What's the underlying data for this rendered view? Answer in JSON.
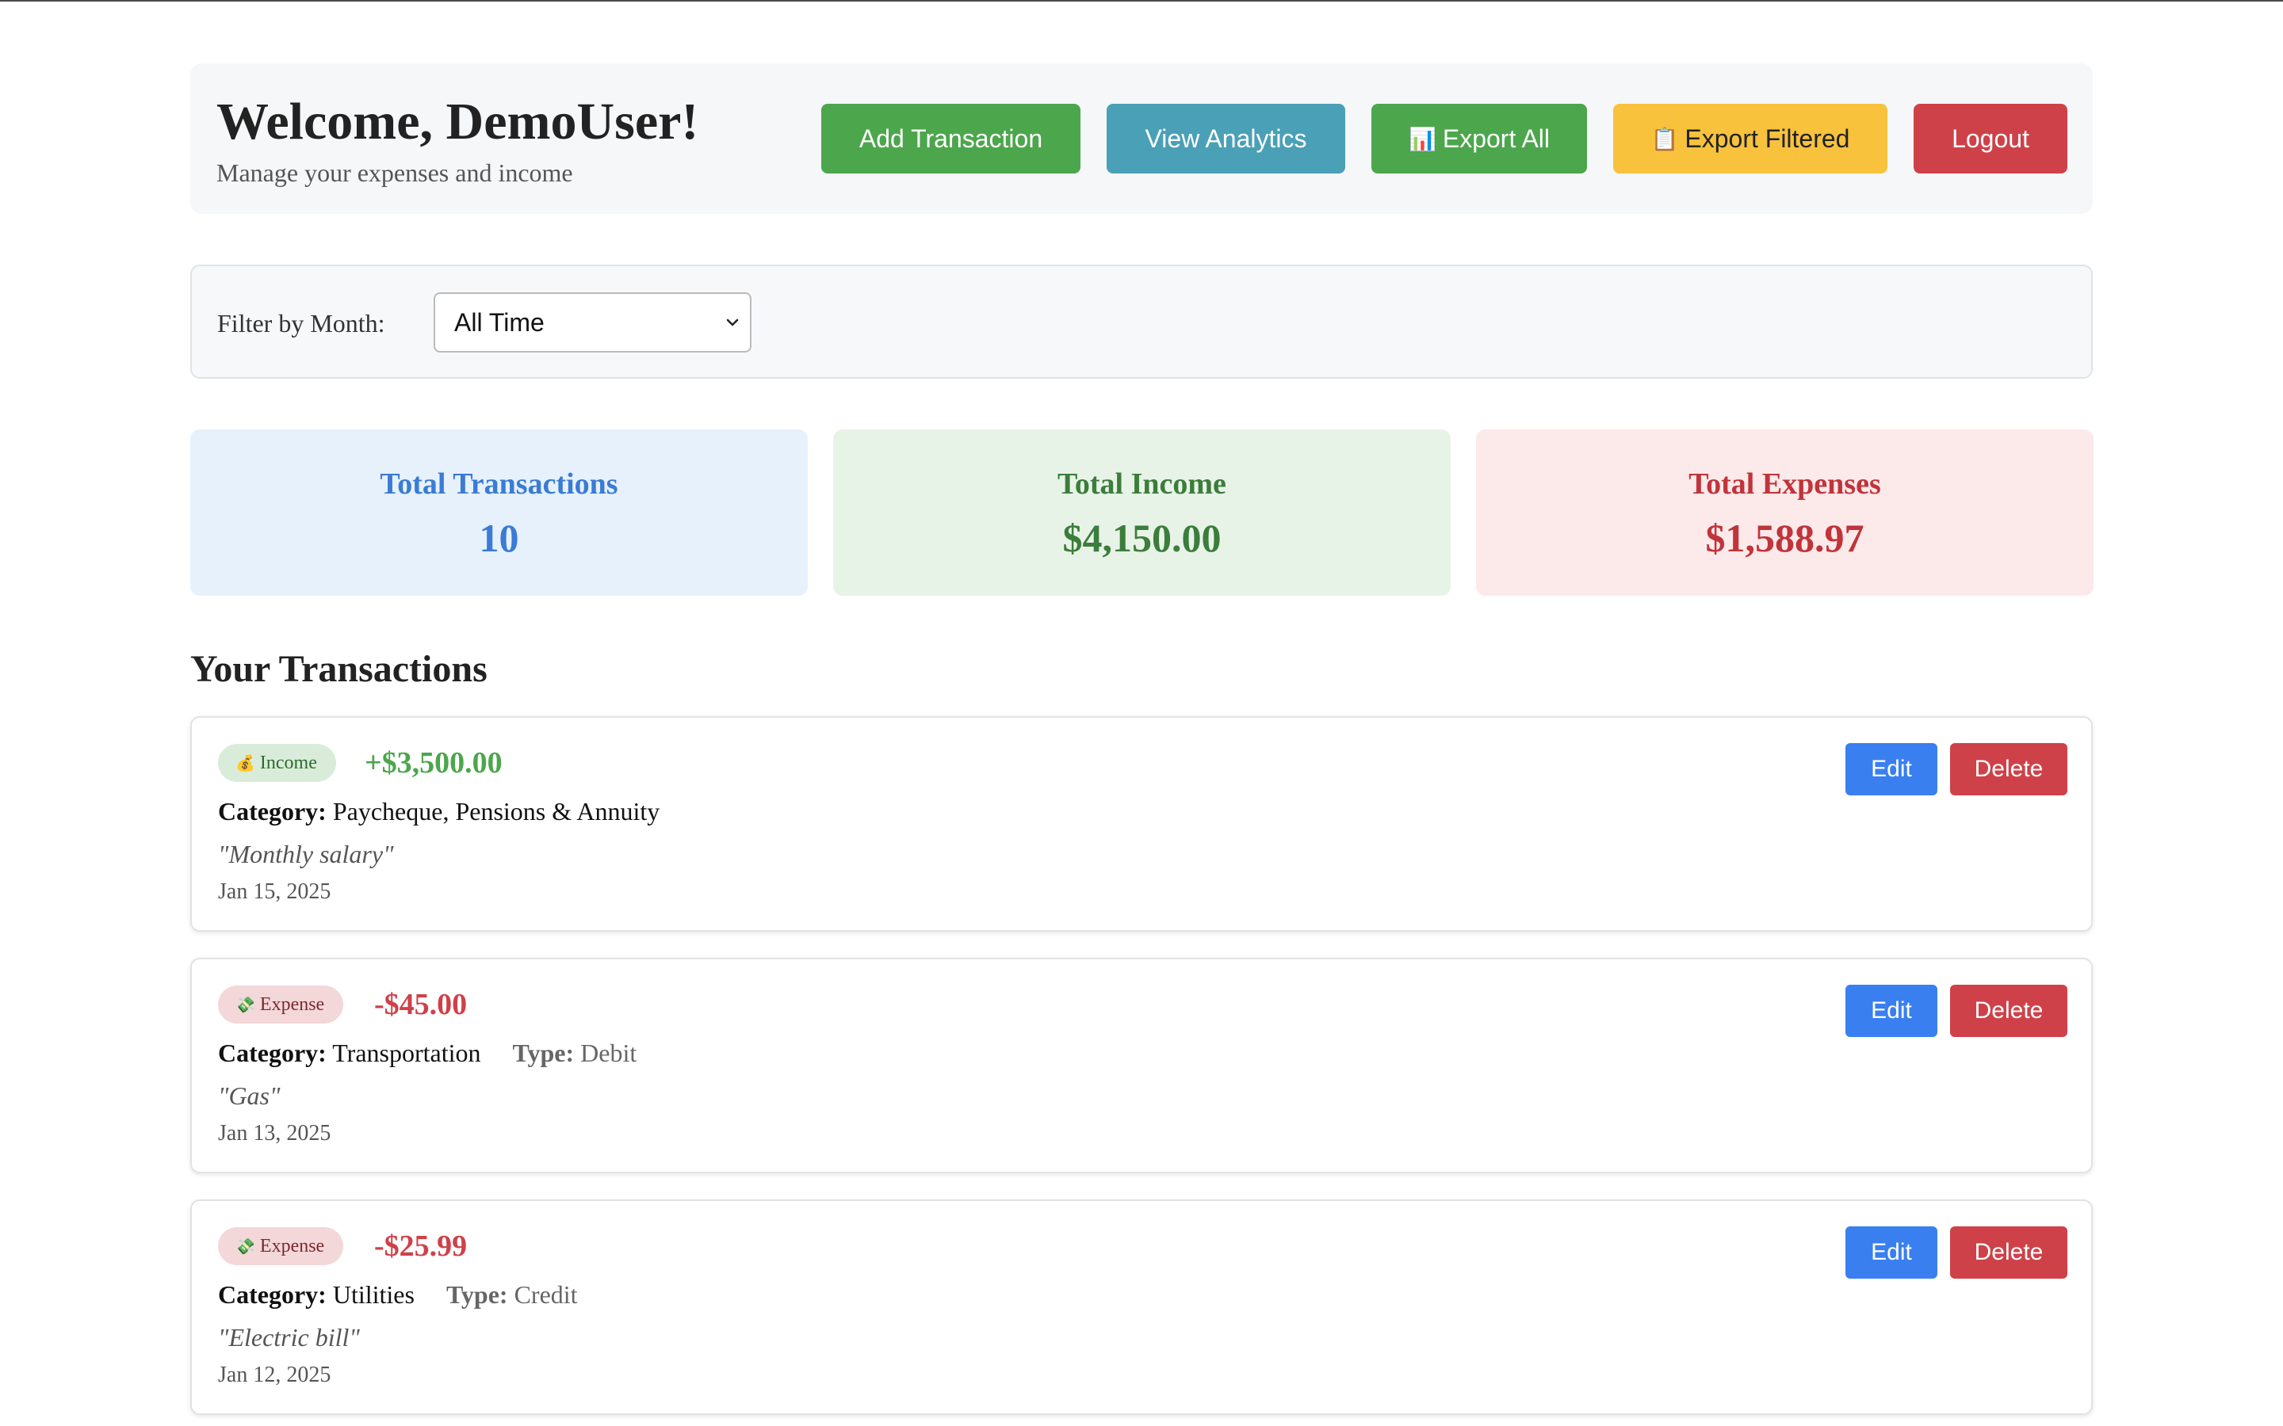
{
  "header": {
    "title": "Welcome, DemoUser!",
    "subtitle": "Manage your expenses and income",
    "buttons": {
      "add": "Add Transaction",
      "analytics": "View Analytics",
      "export_all": "Export All",
      "export_all_icon": "📊",
      "export_filtered": "Export Filtered",
      "export_filtered_icon": "📋",
      "logout": "Logout"
    }
  },
  "filter": {
    "label": "Filter by Month:",
    "selected": "All Time"
  },
  "stats": {
    "transactions": {
      "label": "Total Transactions",
      "value": "10"
    },
    "income": {
      "label": "Total Income",
      "value": "$4,150.00"
    },
    "expenses": {
      "label": "Total Expenses",
      "value": "$1,588.97"
    }
  },
  "section_title": "Your Transactions",
  "transactions": [
    {
      "kind": "Income",
      "badge_icon": "💰",
      "amount": "+$3,500.00",
      "category_label": "Category:",
      "category": "Paycheque, Pensions & Annuity",
      "type_label": "",
      "type": "",
      "note": "\"Monthly salary\"",
      "date": "Jan 15, 2025",
      "edit_label": "Edit",
      "delete_label": "Delete"
    },
    {
      "kind": "Expense",
      "badge_icon": "💸",
      "amount": "-$45.00",
      "category_label": "Category:",
      "category": "Transportation",
      "type_label": "Type:",
      "type": "Debit",
      "note": "\"Gas\"",
      "date": "Jan 13, 2025",
      "edit_label": "Edit",
      "delete_label": "Delete"
    },
    {
      "kind": "Expense",
      "badge_icon": "💸",
      "amount": "-$25.99",
      "category_label": "Category:",
      "category": "Utilities",
      "type_label": "Type:",
      "type": "Credit",
      "note": "\"Electric bill\"",
      "date": "Jan 12, 2025",
      "edit_label": "Edit",
      "delete_label": "Delete"
    }
  ],
  "colors": {
    "success": "#4ca64c",
    "info": "#4aa0b6",
    "warning": "#f8c23d",
    "danger": "#cf4149",
    "primary": "#3a7ff0"
  }
}
